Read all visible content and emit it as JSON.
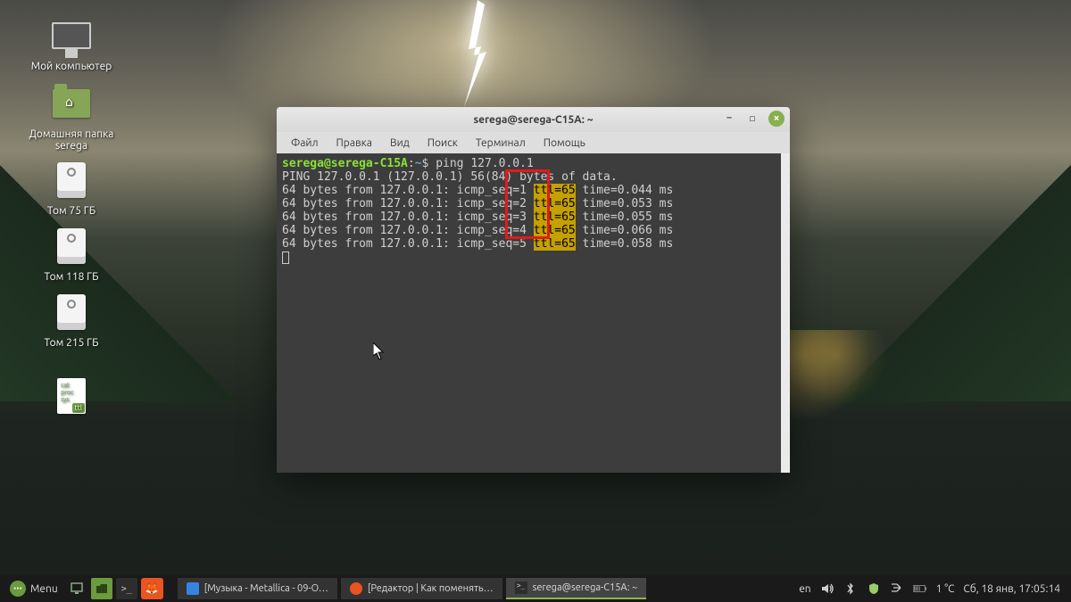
{
  "desktop": {
    "icons": [
      {
        "name": "my-computer",
        "label": "Мой компьютер"
      },
      {
        "name": "home-folder",
        "label": "Домашняя папка serega"
      },
      {
        "name": "volume-75",
        "label": "Том 75 ГБ"
      },
      {
        "name": "volume-118",
        "label": "Том 118 ГБ"
      },
      {
        "name": "volume-215",
        "label": "Том 215 ГБ"
      },
      {
        "name": "ttl-file",
        "label": ""
      }
    ]
  },
  "terminal": {
    "title": "serega@serega-C15A: ~",
    "menus": [
      "Файл",
      "Правка",
      "Вид",
      "Поиск",
      "Терминал",
      "Помощь"
    ],
    "prompt_user": "serega@serega-C15A",
    "prompt_path": "~",
    "command": "ping 127.0.0.1",
    "header": "PING 127.0.0.1 (127.0.0.1) 56(84) bytes of data.",
    "lines": [
      {
        "pre": "64 bytes from 127.0.0.1: icmp_seq=1 ",
        "hl": "ttl=65",
        "post": " time=0.044 ms"
      },
      {
        "pre": "64 bytes from 127.0.0.1: icmp_seq=2 ",
        "hl": "ttl=65",
        "post": " time=0.053 ms"
      },
      {
        "pre": "64 bytes from 127.0.0.1: icmp_seq=3 ",
        "hl": "ttl=65",
        "post": " time=0.055 ms"
      },
      {
        "pre": "64 bytes from 127.0.0.1: icmp_seq=4 ",
        "hl": "ttl=65",
        "post": " time=0.066 ms"
      },
      {
        "pre": "64 bytes from 127.0.0.1: icmp_seq=5 ",
        "hl": "ttl=65",
        "post": " time=0.058 ms"
      }
    ]
  },
  "taskbar": {
    "menu_label": "Menu",
    "items": [
      {
        "label": "[Музыка - Metallica - 09-O…",
        "icon": "music"
      },
      {
        "label": "[Редактор | Как поменять…",
        "icon": "firefox"
      },
      {
        "label": "serega@serega-C15A: ~",
        "icon": "terminal",
        "active": true
      }
    ],
    "tray": {
      "lang": "en",
      "temp": "1 °C",
      "clock": "Сб, 18 янв, 17:05:14"
    }
  }
}
